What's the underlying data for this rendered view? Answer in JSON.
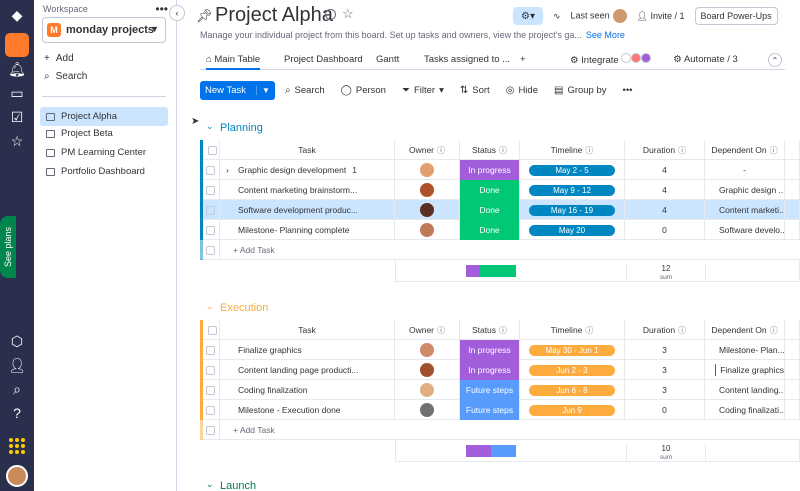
{
  "rail": {
    "see_plans": "See plans"
  },
  "sidebar": {
    "workspace_label": "Workspace",
    "workspace_name": "monday projects",
    "workspace_initial": "M",
    "add_label": "Add",
    "search_label": "Search",
    "boards": [
      "Project Alpha",
      "Project Beta",
      "PM Learning Center",
      "Portfolio Dashboard"
    ]
  },
  "header": {
    "title": "Project Alpha",
    "description": "Manage your individual project from this board. Set up tasks and owners, view the project's ga...",
    "see_more": "See More",
    "last_seen": "Last seen",
    "invite": "Invite / 1",
    "board_powerups": "Board Power-Ups"
  },
  "tabs": [
    "Main Table",
    "Project Dashboard",
    "Gantt",
    "Tasks assigned to ...",
    "+"
  ],
  "tabs_right": {
    "integrate": "Integrate",
    "automate": "Automate / 3"
  },
  "toolbar": {
    "new_task": "New Task",
    "search": "Search",
    "person": "Person",
    "filter": "Filter",
    "sort": "Sort",
    "hide": "Hide",
    "group_by": "Group by"
  },
  "columns": [
    "Task",
    "Owner",
    "Status",
    "Timeline",
    "Duration",
    "Dependent On"
  ],
  "colors": {
    "working": "#a25ddc",
    "done": "#00c875",
    "future": "#579bfc",
    "planning": "#0086c0",
    "execution": "#fdab3d",
    "launch": "#037f4c"
  },
  "groups": [
    {
      "name": "Planning",
      "color": "#0086c0",
      "rows": [
        {
          "task": "Graphic design development",
          "count": "1",
          "status": "In progress",
          "status_color": "#a25ddc",
          "timeline": "May 2 - 5",
          "duration": "4",
          "dependent": "-"
        },
        {
          "task": "Content marketing brainstorm...",
          "status": "Done",
          "status_color": "#00c875",
          "timeline": "May 9 - 12",
          "duration": "4",
          "dependent": "Graphic design ..."
        },
        {
          "task": "Software development produc...",
          "status": "Done",
          "status_color": "#00c875",
          "timeline": "May 16 - 19",
          "duration": "4",
          "dependent": "Content marketi..."
        },
        {
          "task": "Milestone- Planning complete",
          "status": "Done",
          "status_color": "#00c875",
          "timeline": "May 20",
          "duration": "0",
          "dependent": "Software develo..."
        }
      ],
      "add_task": "+ Add Task",
      "sum": "12",
      "sum_label": "sum"
    },
    {
      "name": "Execution",
      "color": "#fdab3d",
      "rows": [
        {
          "task": "Finalize graphics",
          "status": "In progress",
          "status_color": "#a25ddc",
          "timeline": "May 30 - Jun 1",
          "duration": "3",
          "dependent": "Milestone- Plan..."
        },
        {
          "task": "Content landing page producti...",
          "status": "In progress",
          "status_color": "#a25ddc",
          "timeline": "Jun 2 - 3",
          "duration": "3",
          "dependent": "Finalize graphics"
        },
        {
          "task": "Coding finalization",
          "status": "Future steps",
          "status_color": "#579bfc",
          "timeline": "Jun 6 - 8",
          "duration": "3",
          "dependent": "Content landing..."
        },
        {
          "task": "Milestone - Execution done",
          "status": "Future steps",
          "status_color": "#579bfc",
          "timeline": "Jun 9",
          "duration": "0",
          "dependent": "Coding finalizati..."
        }
      ],
      "add_task": "+ Add Task",
      "sum": "10",
      "sum_label": "sum"
    },
    {
      "name": "Launch",
      "color": "#037f4c"
    }
  ]
}
